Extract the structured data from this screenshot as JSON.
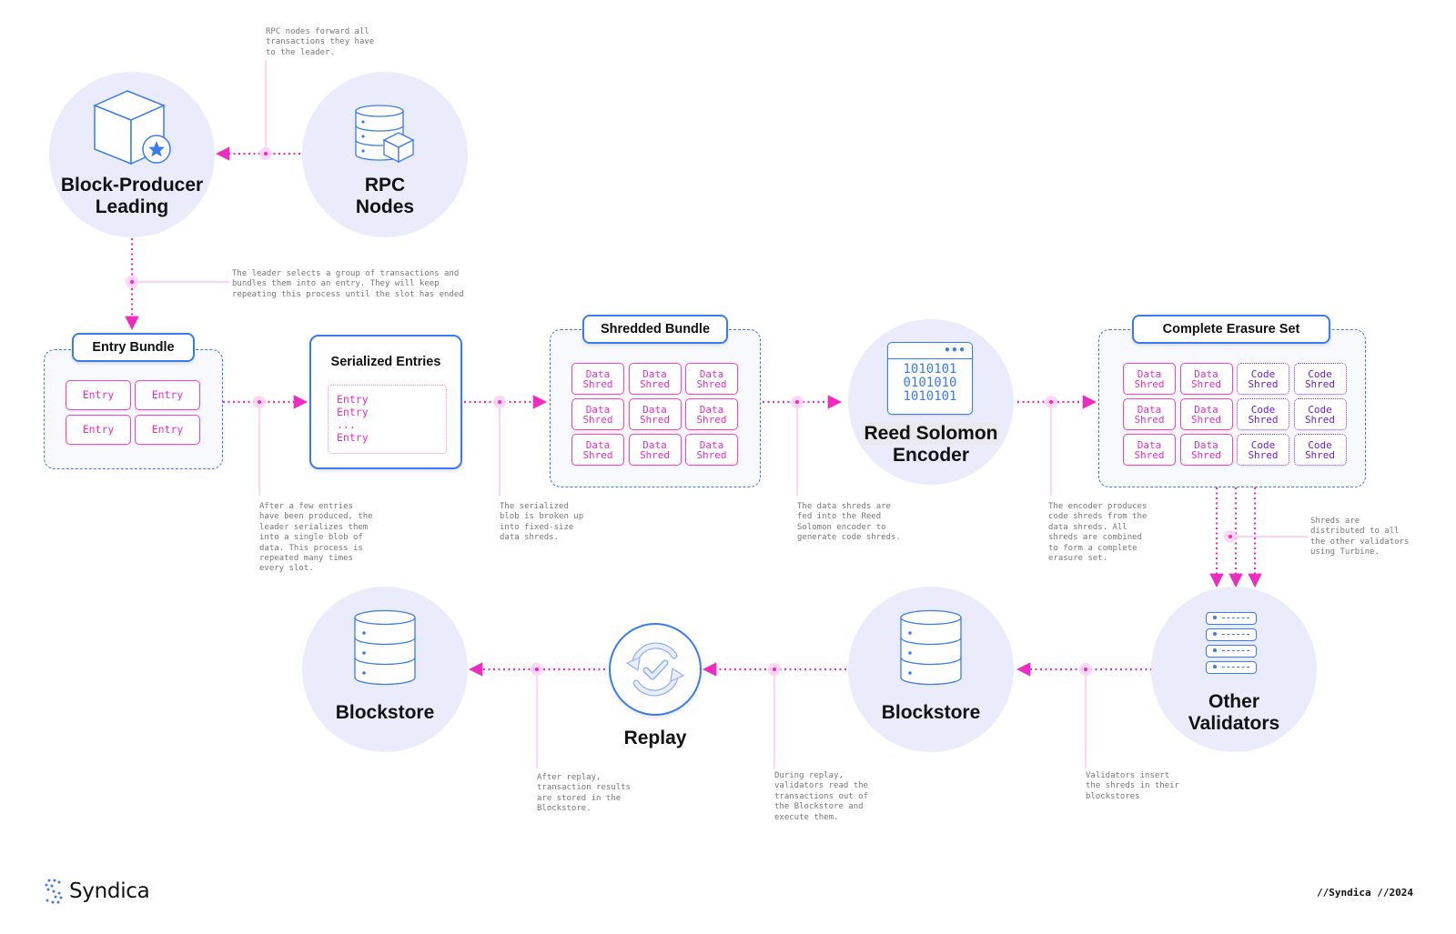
{
  "nodes": {
    "block_producer": {
      "title_line1": "Block-Producer",
      "title_line2": "Leading",
      "icon": "cube-star-icon"
    },
    "rpc_nodes": {
      "title_line1": "RPC",
      "title_line2": "Nodes",
      "icon": "database-cube-icon"
    },
    "reed_solomon": {
      "title_line1": "Reed Solomon",
      "title_line2": "Encoder",
      "icon": "binary-window-icon",
      "binary_lines": [
        "1010101",
        "0101010",
        "1010101"
      ]
    },
    "other_validators": {
      "title_line1": "Other",
      "title_line2": "Validators",
      "icon": "server-rack-icon"
    },
    "blockstore_right": {
      "title": "Blockstore",
      "icon": "database-icon"
    },
    "replay": {
      "title": "Replay",
      "icon": "replay-check-icon"
    },
    "blockstore_left": {
      "title": "Blockstore",
      "icon": "database-icon"
    }
  },
  "groups": {
    "entry_bundle": {
      "label": "Entry Bundle",
      "cells": [
        "Entry",
        "Entry",
        "Entry",
        "Entry"
      ]
    },
    "serialized_entries": {
      "label": "Serialized Entries",
      "lines": "Entry\nEntry\n...\nEntry"
    },
    "shredded_bundle": {
      "label": "Shredded Bundle",
      "cells": [
        "Data\nShred",
        "Data\nShred",
        "Data\nShred",
        "Data\nShred",
        "Data\nShred",
        "Data\nShred",
        "Data\nShred",
        "Data\nShred",
        "Data\nShred"
      ]
    },
    "complete_erasure_set": {
      "label": "Complete Erasure Set",
      "cells": [
        {
          "text": "Data\nShred",
          "kind": "data"
        },
        {
          "text": "Data\nShred",
          "kind": "data"
        },
        {
          "text": "Code\nShred",
          "kind": "code"
        },
        {
          "text": "Code\nShred",
          "kind": "code"
        },
        {
          "text": "Data\nShred",
          "kind": "data"
        },
        {
          "text": "Data\nShred",
          "kind": "data"
        },
        {
          "text": "Code\nShred",
          "kind": "code"
        },
        {
          "text": "Code\nShred",
          "kind": "code"
        },
        {
          "text": "Data\nShred",
          "kind": "data"
        },
        {
          "text": "Data\nShred",
          "kind": "data"
        },
        {
          "text": "Code\nShred",
          "kind": "code"
        },
        {
          "text": "Code\nShred",
          "kind": "code"
        }
      ]
    }
  },
  "notes": {
    "rpc_forward": "RPC nodes forward all\ntransactions they have\nto the leader.",
    "leader_selects": "The leader selects a group of transactions and\nbundles them into an entry. They will keep\nrepeating this process until the slot has ended",
    "serialize": "After a few entries\nhave been produced, the\nleader serializes them\ninto a single blob of\ndata. This process is\nrepeated many times\nevery slot.",
    "shred": "The serialized\nblob is broken up\ninto fixed-size\ndata shreds.",
    "encoder_input": "The data shreds are\nfed into the Reed\nSolomon encoder to\ngenerate code shreds.",
    "encoder_output": "The encoder produces\ncode shreds from the\ndata shreds. All\nshreds are combined\nto form a complete\nerasure set.",
    "turbine": "Shreds are\ndistributed to all\nthe other validators\nusing Turbine.",
    "insert": "Validators insert\nthe shreds in their\nblockstores",
    "replay_read": "During replay,\nvalidators read the\ntransactions out of\nthe Blockstore and\nexecute them.",
    "replay_store": "After replay,\ntransaction results\nare stored in the\nBlockstore."
  },
  "footer": {
    "brand": "Syndica",
    "credit": "//Syndica //2024"
  },
  "colors": {
    "accent_blue": "#3b7bf0",
    "arrow_pink": "#f02cc0",
    "code_purple": "#6a1fd6",
    "circle_fill": "#eaebfb"
  }
}
